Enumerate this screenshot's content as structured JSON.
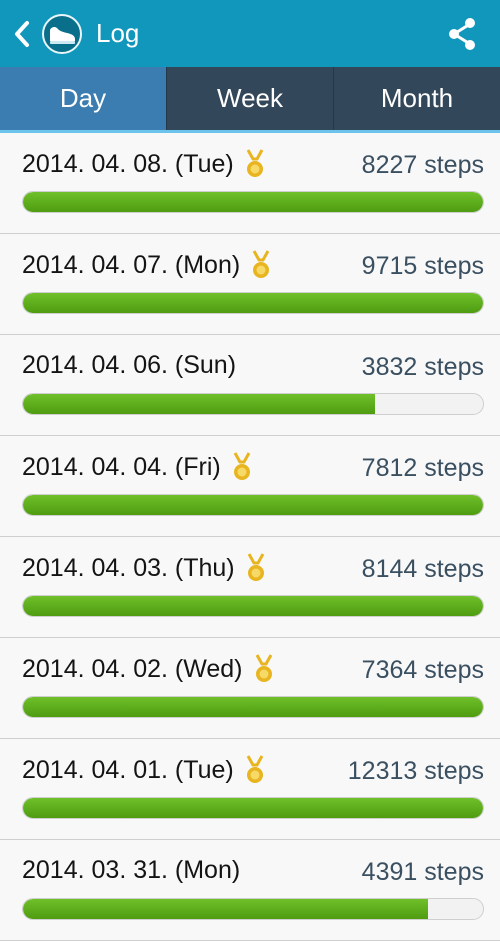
{
  "header": {
    "back_icon": "chevron-left-icon",
    "app_icon": "shoe-icon",
    "title": "Log",
    "share_icon": "share-icon"
  },
  "tabs": [
    {
      "label": "Day",
      "active": true
    },
    {
      "label": "Week",
      "active": false
    },
    {
      "label": "Month",
      "active": false
    }
  ],
  "colors": {
    "appbar": "#1197bb",
    "tab_active": "#3b7db0",
    "tab_inactive": "#33475a",
    "bar_fill": "#5aad18",
    "medal": "#e8b520"
  },
  "log": [
    {
      "date": "2014. 04. 08. (Tue)",
      "steps": "8227 steps",
      "medal": true,
      "progress": 1.0
    },
    {
      "date": "2014. 04. 07. (Mon)",
      "steps": "9715 steps",
      "medal": true,
      "progress": 1.0
    },
    {
      "date": "2014. 04. 06. (Sun)",
      "steps": "3832 steps",
      "medal": false,
      "progress": 0.766
    },
    {
      "date": "2014. 04. 04. (Fri)",
      "steps": "7812 steps",
      "medal": true,
      "progress": 1.0
    },
    {
      "date": "2014. 04. 03. (Thu)",
      "steps": "8144 steps",
      "medal": true,
      "progress": 1.0
    },
    {
      "date": "2014. 04. 02. (Wed)",
      "steps": "7364 steps",
      "medal": true,
      "progress": 1.0
    },
    {
      "date": "2014. 04. 01. (Tue)",
      "steps": "12313 steps",
      "medal": true,
      "progress": 1.0
    },
    {
      "date": "2014. 03. 31. (Mon)",
      "steps": "4391 steps",
      "medal": false,
      "progress": 0.88
    }
  ]
}
